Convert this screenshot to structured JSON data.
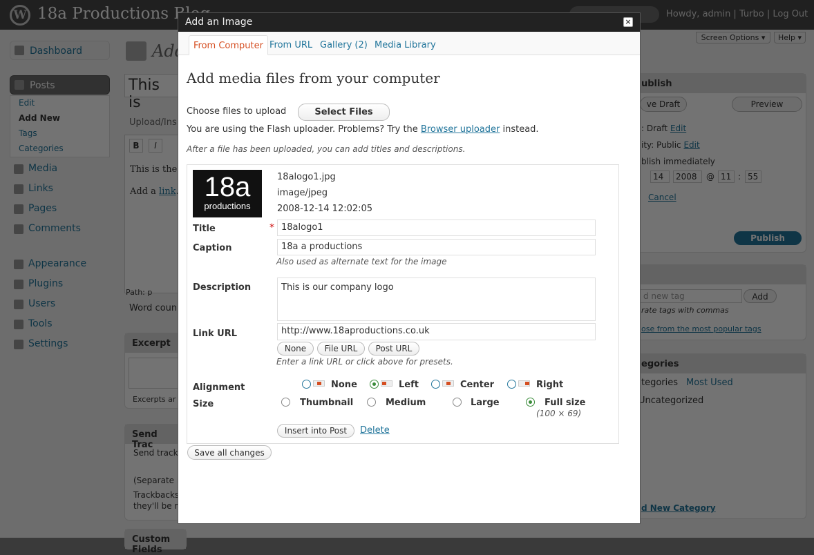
{
  "admin": {
    "blog_title": "18a Productions Blog",
    "wp_logo": "W",
    "user_links": "Howdy, admin | Turbo | Log Out",
    "screen_options": "Screen Options ▾",
    "help": "Help ▾",
    "page_title_partial": "Add",
    "post_title_partial": "This is",
    "menu": {
      "dashboard": "Dashboard",
      "posts": "Posts",
      "posts_sub": [
        "Edit",
        "Add New",
        "Tags",
        "Categories"
      ],
      "items": [
        "Media",
        "Links",
        "Pages",
        "Comments"
      ],
      "items2": [
        "Appearance",
        "Plugins",
        "Users",
        "Tools",
        "Settings"
      ]
    },
    "editor": {
      "upload_insert": "Upload/Ins",
      "bold": "B",
      "italic": "I",
      "line1": "This is the r",
      "line2_prefix": "Add a ",
      "line2_link": "link",
      "line2_suffix": "...",
      "path": "Path: p",
      "word_count": "Word coun"
    },
    "excerpt": {
      "title": "Excerpt",
      "help": "Excerpts ar"
    },
    "trackbacks": {
      "title": "Send Trac",
      "line1": "Send track",
      "line2": "(Separate m",
      "line3": "Trackbacks",
      "line4": "they'll be n"
    },
    "custom_fields": "Custom Fields",
    "publish": {
      "title": "ublish",
      "save_draft": "ve Draft",
      "preview": "Preview",
      "status": ": Draft",
      "status_edit": "Edit",
      "visibility": "ity: Public",
      "visibility_edit": "Edit",
      "publish_when": "blish immediately",
      "day": "14",
      "year": "2008",
      "at": "@",
      "hour": "11",
      "min": "55",
      "colon": ":",
      "cancel": "Cancel",
      "publish_btn": "Publish"
    },
    "tags": {
      "placeholder": "d new tag",
      "add": "Add",
      "sep": "rate tags with commas",
      "popular": "ose from the most popular tags"
    },
    "categories": {
      "title": "egories",
      "all_tab": "tegories",
      "most_used": "Most Used",
      "item": "Uncategorized",
      "add_new": "d New Category"
    }
  },
  "modal": {
    "title": "Add an Image",
    "close_glyph": "×",
    "tabs": [
      "From Computer",
      "From URL",
      "Gallery (2)",
      "Media Library"
    ],
    "heading": "Add media files from your computer",
    "choose_label": "Choose files to upload",
    "select_files": "Select Files",
    "flash_notice_prefix": "You are using the Flash uploader. Problems? Try the ",
    "flash_notice_link": "Browser uploader",
    "flash_notice_suffix": " instead.",
    "after_upload_note": "After a file has been uploaded, you can add titles and descriptions.",
    "file": {
      "thumb_line1": "18a",
      "thumb_line2": "productions",
      "filename": "18alogo1.jpg",
      "mime": "image/jpeg",
      "date": "2008-12-14 12:02:05"
    },
    "fields": {
      "title_label": "Title",
      "required_mark": "*",
      "title_value": "18alogo1",
      "caption_label": "Caption",
      "caption_value": "18a a productions",
      "caption_help": "Also used as alternate text for the image",
      "description_label": "Description",
      "description_value": "This is our company logo",
      "link_label": "Link URL",
      "link_value": "http://www.18aproductions.co.uk",
      "link_buttons": [
        "None",
        "File URL",
        "Post URL"
      ],
      "link_help": "Enter a link URL or click above for presets.",
      "alignment_label": "Alignment",
      "alignment_options": [
        "None",
        "Left",
        "Center",
        "Right"
      ],
      "alignment_selected": "Left",
      "size_label": "Size",
      "size_options": [
        "Thumbnail",
        "Medium",
        "Large",
        "Full size"
      ],
      "size_selected": "Full size",
      "full_size_dims": "(100 × 69)"
    },
    "insert_button": "Insert into Post",
    "delete_link": "Delete",
    "save_all": "Save all changes"
  }
}
